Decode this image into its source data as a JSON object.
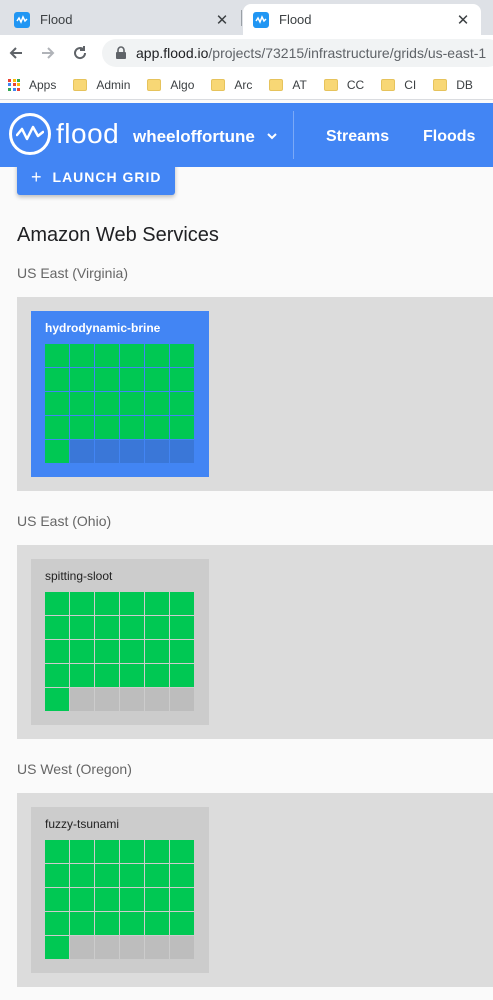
{
  "browser": {
    "tabs": [
      {
        "title": "Flood",
        "active": false
      },
      {
        "title": "Flood",
        "active": true
      }
    ],
    "close_glyph": "✕",
    "url_host": "app.flood.io",
    "url_path": "/projects/73215/infrastructure/grids/us-east-1",
    "bookmarks": [
      "Apps",
      "Admin",
      "Algo",
      "Arc",
      "AT",
      "CC",
      "CI",
      "DB"
    ]
  },
  "header": {
    "logo_text": "flood",
    "workspace": "wheeloffortune",
    "nav": [
      "Streams",
      "Floods"
    ]
  },
  "main": {
    "launch_button": "LAUNCH GRID",
    "provider_title": "Amazon Web Services",
    "regions": [
      {
        "label": "US East (Virginia)",
        "grid_name": "hydrodynamic-brine",
        "selected": true,
        "nodes_online": 25,
        "nodes_total": 30
      },
      {
        "label": "US East (Ohio)",
        "grid_name": "spitting-sloot",
        "selected": false,
        "nodes_online": 25,
        "nodes_total": 30
      },
      {
        "label": "US West (Oregon)",
        "grid_name": "fuzzy-tsunami",
        "selected": false,
        "nodes_online": 25,
        "nodes_total": 30
      }
    ]
  },
  "colors": {
    "brand_blue": "#4285f4",
    "node_online": "#00c853",
    "node_offline": "#bdbdbd"
  }
}
